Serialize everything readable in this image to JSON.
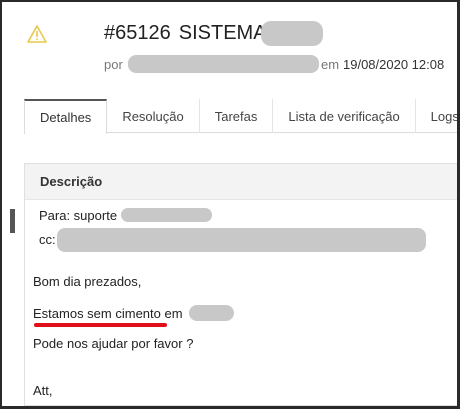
{
  "header": {
    "ticket_number": "#65126",
    "title_prefix": "SISTEMA-",
    "meta_by": "por",
    "meta_at": "em",
    "meta_date": "19/08/2020 12:08",
    "warning_icon": "warning-triangle-icon"
  },
  "tabs": [
    {
      "label": "Detalhes",
      "active": true
    },
    {
      "label": "Resolução",
      "active": false
    },
    {
      "label": "Tarefas",
      "active": false
    },
    {
      "label": "Lista de verificação",
      "active": false
    },
    {
      "label": "Logs",
      "active": false
    }
  ],
  "description": {
    "heading": "Descrição",
    "to_label": "Para: suporte",
    "cc_label": "cc:",
    "greeting": "Bom dia prezados,",
    "line1": "Estamos sem cimento em",
    "line2": "Pode nos ajudar por favor ?",
    "closing": "Att,"
  },
  "colors": {
    "highlight": "#e0101a",
    "warning": "#e8c84a"
  }
}
